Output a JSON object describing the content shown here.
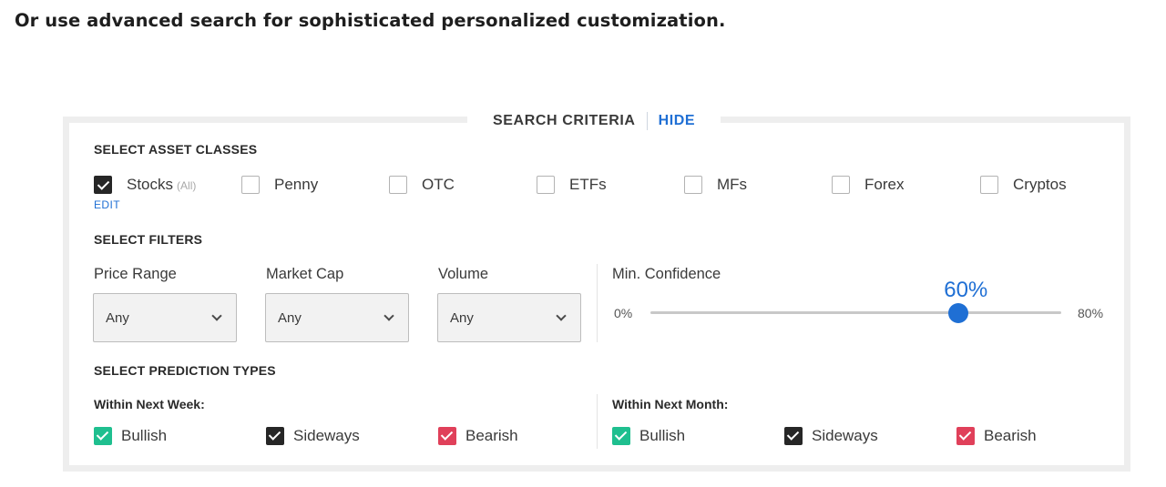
{
  "heading": "Or use advanced search for sophisticated personalized customization.",
  "panel": {
    "title": "SEARCH CRITERIA",
    "hide_label": "HIDE"
  },
  "asset_classes": {
    "label": "SELECT ASSET CLASSES",
    "edit_label": "EDIT",
    "items": [
      {
        "label": "Stocks",
        "sub": "(All)",
        "checked": true
      },
      {
        "label": "Penny",
        "checked": false
      },
      {
        "label": "OTC",
        "checked": false
      },
      {
        "label": "ETFs",
        "checked": false
      },
      {
        "label": "MFs",
        "checked": false
      },
      {
        "label": "Forex",
        "checked": false
      },
      {
        "label": "Cryptos",
        "checked": false
      }
    ]
  },
  "filters": {
    "label": "SELECT FILTERS",
    "price_range": {
      "label": "Price Range",
      "value": "Any"
    },
    "market_cap": {
      "label": "Market Cap",
      "value": "Any"
    },
    "volume": {
      "label": "Volume",
      "value": "Any"
    },
    "confidence": {
      "label": "Min. Confidence",
      "min_label": "0%",
      "max_label": "80%",
      "value_label": "60%",
      "value_fraction": 0.75
    }
  },
  "prediction_types": {
    "label": "SELECT PREDICTION TYPES",
    "week": {
      "label": "Within Next Week:",
      "items": [
        {
          "label": "Bullish",
          "color": "#1fbf8f",
          "checked": true
        },
        {
          "label": "Sideways",
          "color": "#262626",
          "checked": true
        },
        {
          "label": "Bearish",
          "color": "#e0405a",
          "checked": true
        }
      ]
    },
    "month": {
      "label": "Within Next Month:",
      "items": [
        {
          "label": "Bullish",
          "color": "#1fbf8f",
          "checked": true
        },
        {
          "label": "Sideways",
          "color": "#262626",
          "checked": true
        },
        {
          "label": "Bearish",
          "color": "#e0405a",
          "checked": true
        }
      ]
    }
  },
  "colors": {
    "accent": "#1f6fd4",
    "bullish": "#1fbf8f",
    "sideways": "#262626",
    "bearish": "#e0405a"
  }
}
